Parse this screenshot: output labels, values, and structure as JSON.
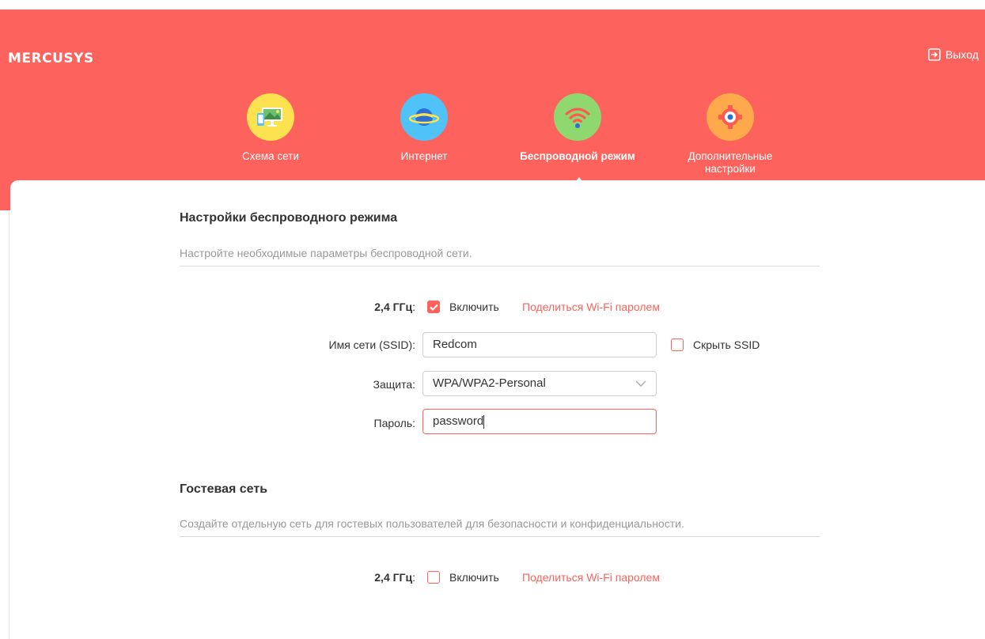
{
  "brand": {
    "logo": "MERCUSYS",
    "accent": "#fe625c"
  },
  "header": {
    "logout_label": "Выход"
  },
  "nav": {
    "items": [
      {
        "label": "Схема сети",
        "icon": "network-map-icon",
        "color": "#fde24f"
      },
      {
        "label": "Интернет",
        "icon": "globe-planet-icon",
        "color": "#4fc3f7"
      },
      {
        "label": "Беспроводной режим",
        "icon": "wifi-icon",
        "color": "#8fd86f",
        "active": true
      },
      {
        "label": "Дополнительные настройки",
        "icon": "gear-icon",
        "color": "#ffa94d"
      }
    ]
  },
  "wireless": {
    "title": "Настройки беспроводного режима",
    "description": "Настройте необходимые параметры беспроводной сети.",
    "band_label": "2,4 ГГц",
    "enable_label": "Включить",
    "enable_checked": true,
    "share_label": "Поделиться Wi-Fi паролем",
    "ssid_label": "Имя сети (SSID):",
    "ssid_value": "Redcom",
    "hide_ssid_label": "Скрыть SSID",
    "hide_ssid_checked": false,
    "security_label": "Защита:",
    "security_value": "WPA/WPA2-Personal",
    "password_label": "Пароль:",
    "password_value": "password"
  },
  "guest": {
    "title": "Гостевая сеть",
    "description": "Создайте отдельную сеть для гостевых пользователей для безопасности и конфиденциальности.",
    "band_label": "2,4 ГГц",
    "enable_label": "Включить",
    "enable_checked": false,
    "share_label": "Поделиться Wi-Fi паролем"
  }
}
